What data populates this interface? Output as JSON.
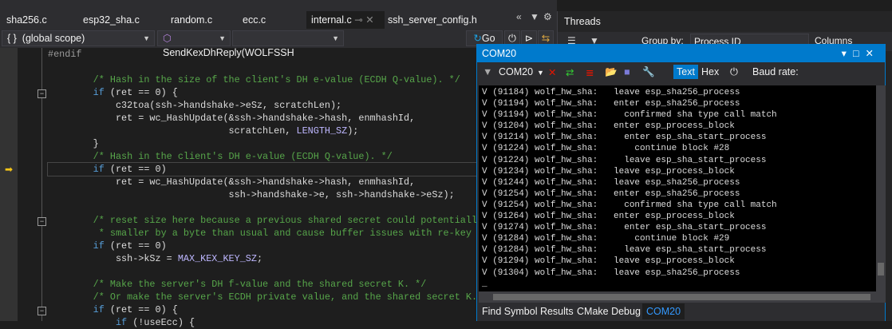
{
  "editor_tabs": [
    "sha256.c",
    "esp32_sha.c",
    "random.c",
    "ecc.c",
    "internal.c",
    "ssh_server_config.h"
  ],
  "active_tab": "internal.c",
  "nav": {
    "scope": "(global scope)",
    "function": "SendKexDhReply(WOLFSSH",
    "member": "",
    "go": "Go"
  },
  "code_lines": [
    [
      [
        "#endif",
        "p"
      ]
    ],
    [],
    [
      [
        "        ",
        "t"
      ],
      [
        "/* Hash in the size of the client's DH e-value (ECDH Q-value). */",
        "c"
      ]
    ],
    [
      [
        "        ",
        "t"
      ],
      [
        "if",
        "k"
      ],
      [
        " (ret == 0) {",
        "t"
      ]
    ],
    [
      [
        "            c32toa(ssh->handshake->eSz, scratchLen);",
        "t"
      ]
    ],
    [
      [
        "            ret = wc_HashUpdate(&ssh->handshake->hash, enmhashId,",
        "t"
      ]
    ],
    [
      [
        "                                scratchLen, ",
        "t"
      ],
      [
        "LENGTH_SZ",
        "mc"
      ],
      [
        ");",
        "t"
      ]
    ],
    [
      [
        "        }",
        "t"
      ]
    ],
    [
      [
        "        ",
        "t"
      ],
      [
        "/* Hash in the client's DH e-value (ECDH Q-value). */",
        "c"
      ]
    ],
    [
      [
        "        ",
        "t"
      ],
      [
        "if",
        "k"
      ],
      [
        " (ret == 0)",
        "t"
      ]
    ],
    [
      [
        "            ret = wc_HashUpdate(&ssh->handshake->hash, enmhashId,",
        "t"
      ]
    ],
    [
      [
        "                                ssh->handshake->e, ssh->handshake->eSz);",
        "t"
      ]
    ],
    [],
    [
      [
        "        ",
        "t"
      ],
      [
        "/* reset size here because a previous shared secret could potentially be",
        "c"
      ]
    ],
    [
      [
        "         ",
        "t"
      ],
      [
        "* smaller by a byte than usual and cause buffer issues with re-key */",
        "c"
      ]
    ],
    [
      [
        "        ",
        "t"
      ],
      [
        "if",
        "k"
      ],
      [
        " (ret == 0)",
        "t"
      ]
    ],
    [
      [
        "            ssh->kSz = ",
        "t"
      ],
      [
        "MAX_KEX_KEY_SZ",
        "mc"
      ],
      [
        ";",
        "t"
      ]
    ],
    [],
    [
      [
        "        ",
        "t"
      ],
      [
        "/* Make the server's DH f-value and the shared secret K. */",
        "c"
      ]
    ],
    [
      [
        "        ",
        "t"
      ],
      [
        "/* Or make the server's ECDH private value, and the shared secret K. */",
        "c"
      ]
    ],
    [
      [
        "        ",
        "t"
      ],
      [
        "if",
        "k"
      ],
      [
        " (ret == 0) {",
        "t"
      ]
    ],
    [
      [
        "            ",
        "t"
      ],
      [
        "if",
        "k"
      ],
      [
        " (!useEcc) {",
        "t"
      ]
    ]
  ],
  "threads": {
    "title": "Threads",
    "group_by_label": "Group by:",
    "group_by_value": "Process ID",
    "columns": "Columns"
  },
  "com": {
    "title": "COM20",
    "port": "COM20",
    "text_btn": "Text",
    "hex_btn": "Hex",
    "baud_label": "Baud rate:",
    "lines": [
      "V (91184) wolf_hw_sha:   leave esp_sha256_process",
      "V (91194) wolf_hw_sha:   enter esp_sha256_process",
      "V (91194) wolf_hw_sha:     confirmed sha type call match",
      "V (91204) wolf_hw_sha:   enter esp_process_block",
      "V (91214) wolf_hw_sha:     enter esp_sha_start_process",
      "V (91224) wolf_hw_sha:       continue block #28",
      "V (91224) wolf_hw_sha:     leave esp_sha_start_process",
      "V (91234) wolf_hw_sha:   leave esp_process_block",
      "V (91244) wolf_hw_sha:   leave esp_sha256_process",
      "V (91254) wolf_hw_sha:   enter esp_sha256_process",
      "V (91254) wolf_hw_sha:     confirmed sha type call match",
      "V (91264) wolf_hw_sha:   enter esp_process_block",
      "V (91274) wolf_hw_sha:     enter esp_sha_start_process",
      "V (91284) wolf_hw_sha:       continue block #29",
      "V (91284) wolf_hw_sha:     leave esp_sha_start_process",
      "V (91294) wolf_hw_sha:   leave esp_process_block",
      "V (91304) wolf_hw_sha:   leave esp_sha256_process",
      "_"
    ]
  },
  "bottom_tabs": [
    "Find Symbol Results",
    "CMake Debug",
    "COM20"
  ]
}
